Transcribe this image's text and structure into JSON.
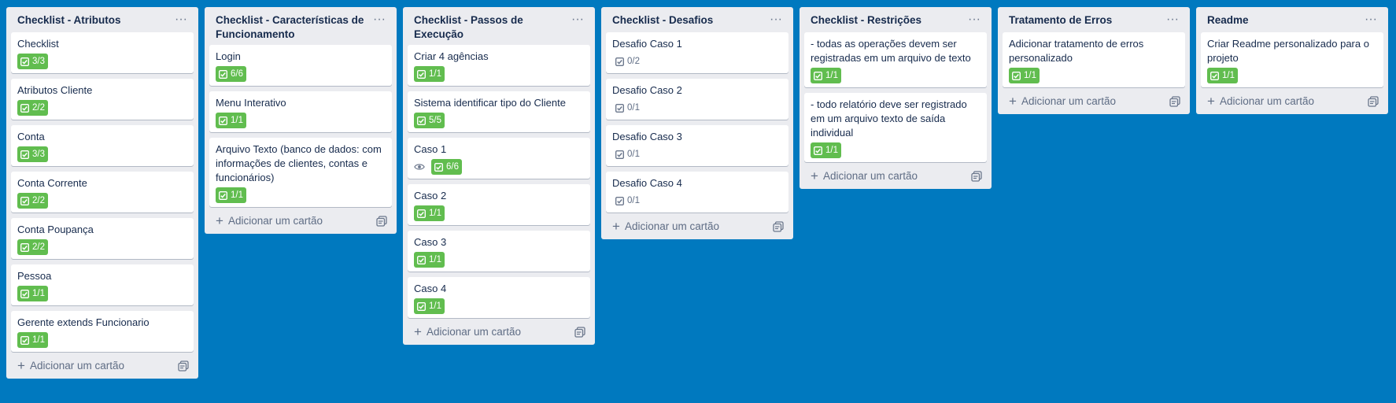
{
  "colors": {
    "board_bg": "#0079bf",
    "list_bg": "#ebecf0",
    "badge_complete": "#61bd4f"
  },
  "icons": {
    "list_menu": "ellipsis-icon",
    "checklist": "checklist-icon",
    "watch": "eye-icon",
    "add": "plus-icon",
    "template": "card-template-icon"
  },
  "add_card_label": "Adicionar um cartão",
  "list_menu_glyph": "···",
  "lists": [
    {
      "title": "Checklist - Atributos",
      "cards": [
        {
          "title": "Checklist",
          "checklist": "3/3",
          "complete": true
        },
        {
          "title": "Atributos Cliente",
          "checklist": "2/2",
          "complete": true
        },
        {
          "title": "Conta",
          "checklist": "3/3",
          "complete": true
        },
        {
          "title": "Conta Corrente",
          "checklist": "2/2",
          "complete": true
        },
        {
          "title": "Conta Poupança",
          "checklist": "2/2",
          "complete": true
        },
        {
          "title": "Pessoa",
          "checklist": "1/1",
          "complete": true
        },
        {
          "title": "Gerente extends Funcionario",
          "checklist": "1/1",
          "complete": true
        }
      ]
    },
    {
      "title": "Checklist - Características de Funcionamento",
      "cards": [
        {
          "title": "Login",
          "checklist": "6/6",
          "complete": true
        },
        {
          "title": "Menu Interativo",
          "checklist": "1/1",
          "complete": true
        },
        {
          "title": "Arquivo Texto (banco de dados: com informações de clientes, contas e funcionários)",
          "checklist": "1/1",
          "complete": true
        }
      ]
    },
    {
      "title": "Checklist - Passos de Execução",
      "cards": [
        {
          "title": "Criar 4 agências",
          "checklist": "1/1",
          "complete": true
        },
        {
          "title": "Sistema identificar tipo do Cliente",
          "checklist": "5/5",
          "complete": true
        },
        {
          "title": "Caso 1",
          "checklist": "6/6",
          "complete": true,
          "watched": true
        },
        {
          "title": "Caso 2",
          "checklist": "1/1",
          "complete": true
        },
        {
          "title": "Caso 3",
          "checklist": "1/1",
          "complete": true
        },
        {
          "title": "Caso 4",
          "checklist": "1/1",
          "complete": true
        }
      ]
    },
    {
      "title": "Checklist - Desafios",
      "cards": [
        {
          "title": "Desafio Caso 1",
          "checklist": "0/2",
          "complete": false
        },
        {
          "title": "Desafio Caso 2",
          "checklist": "0/1",
          "complete": false
        },
        {
          "title": "Desafio Caso 3",
          "checklist": "0/1",
          "complete": false
        },
        {
          "title": "Desafio Caso 4",
          "checklist": "0/1",
          "complete": false
        }
      ]
    },
    {
      "title": "Checklist - Restrições",
      "cards": [
        {
          "title": "- todas as operações devem ser registradas em um arquivo de texto",
          "checklist": "1/1",
          "complete": true
        },
        {
          "title": "- todo relatório deve ser registrado em um arquivo texto de saída individual",
          "checklist": "1/1",
          "complete": true
        }
      ]
    },
    {
      "title": "Tratamento de Erros",
      "cards": [
        {
          "title": "Adicionar tratamento de erros personalizado",
          "checklist": "1/1",
          "complete": true
        }
      ]
    },
    {
      "title": "Readme",
      "cards": [
        {
          "title": "Criar Readme personalizado para o projeto",
          "checklist": "1/1",
          "complete": true
        }
      ]
    }
  ]
}
